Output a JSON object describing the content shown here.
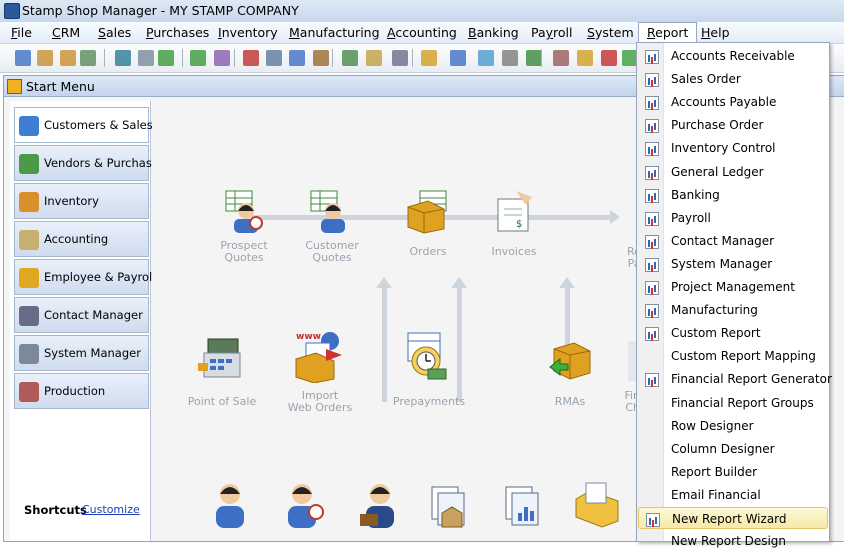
{
  "window": {
    "title": "Stamp Shop Manager - MY STAMP COMPANY"
  },
  "menu": [
    {
      "label": "File",
      "accel": "F",
      "rest": "ile"
    },
    {
      "label": "CRM",
      "accel": "C",
      "rest": "RM"
    },
    {
      "label": "Sales",
      "accel": "S",
      "rest": "ales"
    },
    {
      "label": "Purchases",
      "accel": "P",
      "rest": "urchases"
    },
    {
      "label": "Inventory",
      "accel": "I",
      "rest": "nventory"
    },
    {
      "label": "Manufacturing",
      "accel": "M",
      "rest": "anufacturing"
    },
    {
      "label": "Accounting",
      "accel": "A",
      "rest": "ccounting"
    },
    {
      "label": "Banking",
      "accel": "B",
      "rest": "anking"
    },
    {
      "label": "Payroll",
      "accel": "y",
      "pre": "Pa",
      "rest": "roll"
    },
    {
      "label": "System",
      "accel": "S",
      "rest": "ystem"
    },
    {
      "label": "Report",
      "accel": "R",
      "rest": "eport"
    },
    {
      "label": "Help",
      "accel": "H",
      "rest": "elp"
    }
  ],
  "start_window": {
    "title": "Start Menu"
  },
  "nav": {
    "items": [
      {
        "label": "Customers & Sales"
      },
      {
        "label": "Vendors & Purchasing"
      },
      {
        "label": "Inventory"
      },
      {
        "label": "Accounting"
      },
      {
        "label": "Employee & Payroll"
      },
      {
        "label": "Contact Manager"
      },
      {
        "label": "System Manager"
      },
      {
        "label": "Production"
      }
    ],
    "shortcuts_label": "Shortcuts",
    "customize_label": "Customize"
  },
  "flow": {
    "prospect_quotes": [
      "Prospect",
      "Quotes"
    ],
    "customer_quotes": [
      "Customer",
      "Quotes"
    ],
    "orders": "Orders",
    "invoices": "Invoices",
    "receive_payments_partial": [
      "Rec",
      "Pay"
    ],
    "point_of_sale": "Point of Sale",
    "import_web_orders": [
      "Import",
      "Web Orders"
    ],
    "prepayments": "Prepayments",
    "rmas": "RMAs",
    "finance_charges_partial": [
      "Fin",
      "Ch"
    ]
  },
  "report_menu": {
    "items": [
      "Accounts Receivable",
      "Sales Order",
      "Accounts Payable",
      "Purchase Order",
      "Inventory Control",
      "General Ledger",
      "Banking",
      "Payroll",
      "Contact Manager",
      "System Manager",
      "Project Management",
      "Manufacturing",
      "Custom Report",
      "Custom Report Mapping",
      "Financial Report Generator",
      "Financial Report Groups",
      "Row Designer",
      "Column Designer",
      "Report Builder",
      "Email Financial",
      "New Report Wizard",
      "New Report Design"
    ],
    "highlighted": "New Report Wizard",
    "icons_on": [
      "Accounts Receivable",
      "Sales Order",
      "Accounts Payable",
      "Purchase Order",
      "Inventory Control",
      "General Ledger",
      "Banking",
      "Payroll",
      "Contact Manager",
      "System Manager",
      "Project Management",
      "Manufacturing",
      "Custom Report",
      "Financial Report Generator",
      "New Report Wizard"
    ]
  },
  "colors": {
    "accent": "#2a5a9a",
    "highlight": "#f7e9a8",
    "link": "#1a3fb0"
  }
}
